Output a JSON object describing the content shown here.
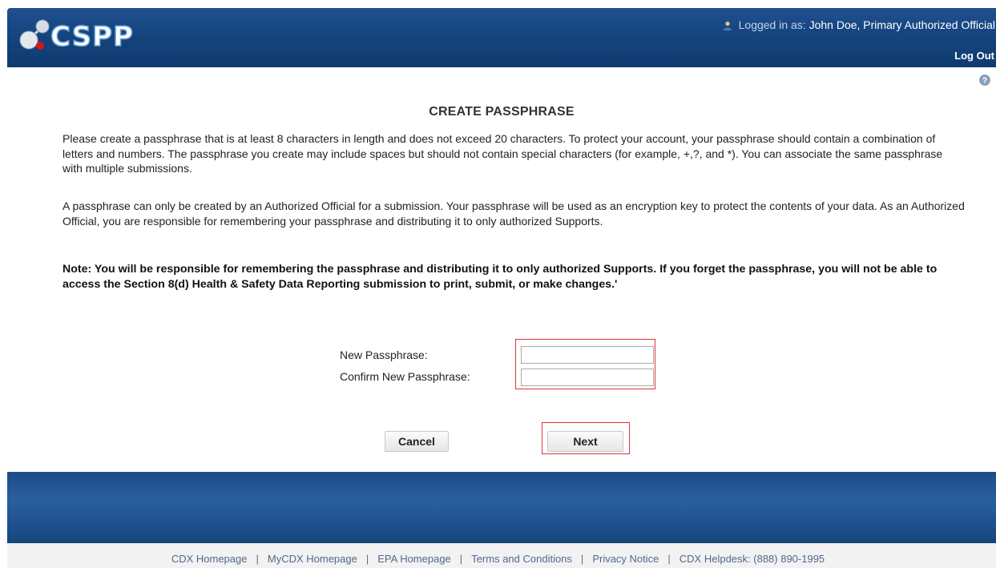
{
  "header": {
    "app_name": "CSPP",
    "logged_in_prefix": "Logged in as:",
    "user": "John Doe, Primary Authorized Official",
    "logout_label": "Log Out"
  },
  "page": {
    "title": "CREATE PASSPHRASE",
    "paragraph1": "Please create a passphrase that is at least 8 characters in length and does not exceed 20 characters. To protect your account, your passphrase should contain a combination of letters and numbers. The passphrase you create may include spaces but should not contain special characters (for example, +,?, and *). You can associate the same passphrase with multiple submissions.",
    "paragraph2": "A passphrase can only be created by an Authorized Official for a submission. Your passphrase will be used as an encryption key to protect the contents of your data. As an Authorized Official, you are responsible for remembering your passphrase and distributing it to only authorized Supports.",
    "note": "Note: You will be responsible for remembering the passphrase and distributing it to only authorized Supports. If you forget the passphrase, you will not be able to access the Section 8(d) Health & Safety Data Reporting submission to print, submit, or make changes.'"
  },
  "form": {
    "new_label": "New Passphrase:",
    "new_value": "",
    "confirm_label": "Confirm New Passphrase:",
    "confirm_value": ""
  },
  "buttons": {
    "cancel": "Cancel",
    "next": "Next"
  },
  "footer": {
    "links": [
      "CDX Homepage",
      "MyCDX Homepage",
      "EPA Homepage",
      "Terms and Conditions",
      "Privacy Notice",
      "CDX Helpdesk: (888) 890-1995"
    ]
  },
  "icons": {
    "logo": "molecule-logo-icon",
    "user": "user-icon",
    "help": "help-icon"
  },
  "colors": {
    "header_blue": "#15457f",
    "highlight_red": "#e0323e"
  }
}
